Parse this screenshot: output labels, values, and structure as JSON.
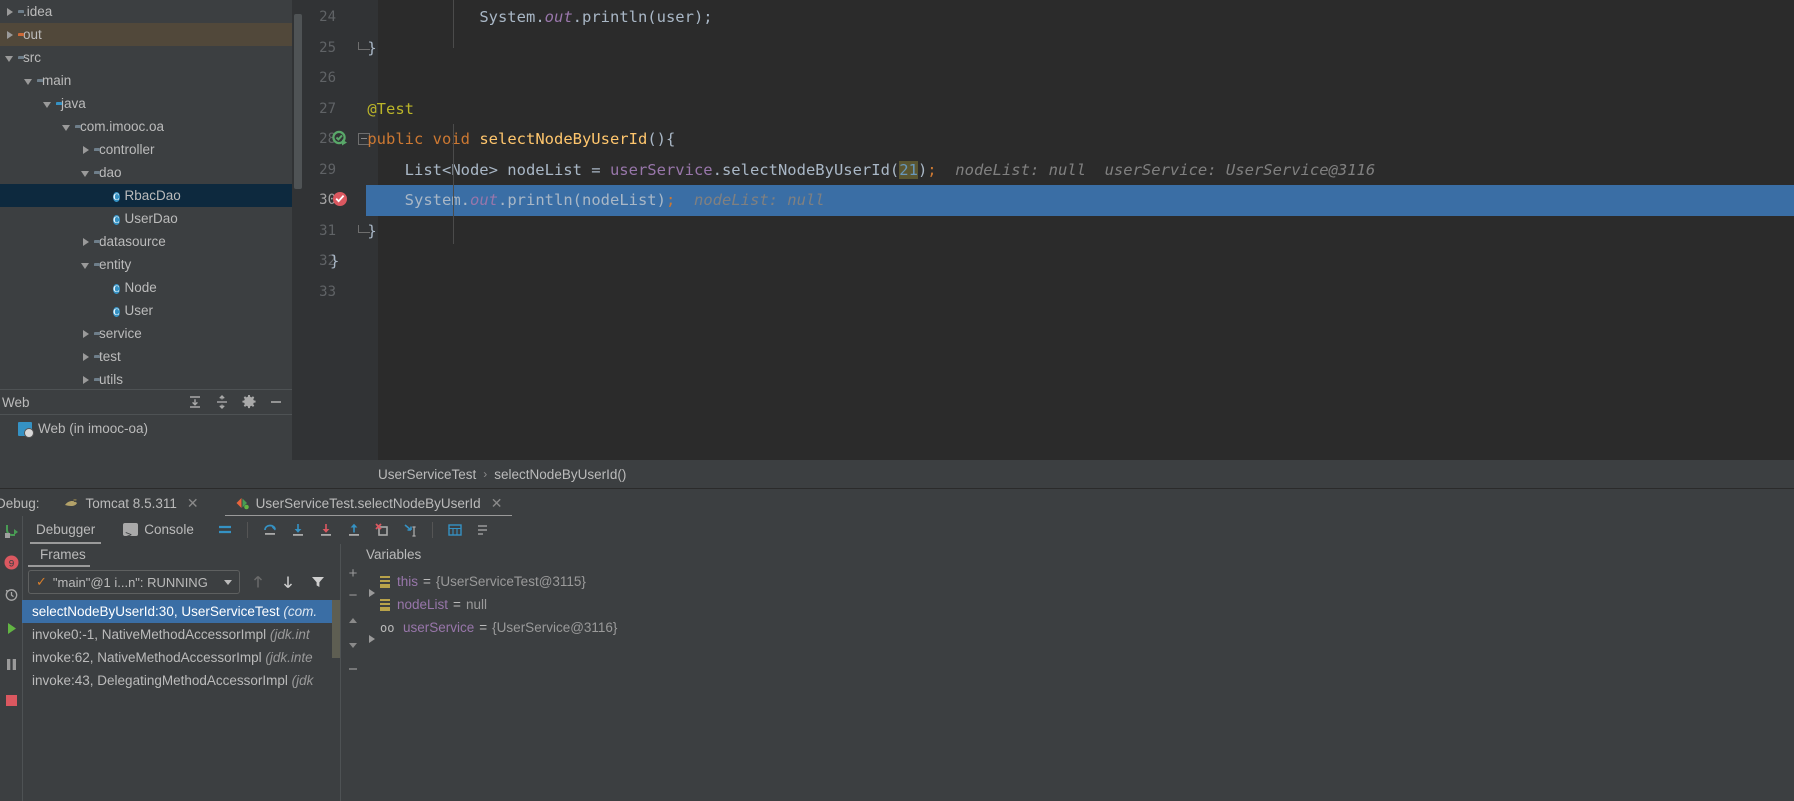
{
  "project_tree": {
    "items": [
      {
        "label": ".idea",
        "indent": 0,
        "arrow": "right",
        "icon": "folder-icon",
        "icon_color": "gray",
        "selected": "none"
      },
      {
        "label": "out",
        "indent": 0,
        "arrow": "right",
        "icon": "folder-icon",
        "icon_color": "orange",
        "selected": "out"
      },
      {
        "label": "src",
        "indent": 0,
        "arrow": "down",
        "icon": "folder-icon",
        "icon_color": "gray",
        "selected": "none"
      },
      {
        "label": "main",
        "indent": 1,
        "arrow": "down",
        "icon": "folder-icon",
        "icon_color": "gray",
        "selected": "none"
      },
      {
        "label": "java",
        "indent": 2,
        "arrow": "down",
        "icon": "folder-icon",
        "icon_color": "blue",
        "selected": "none"
      },
      {
        "label": "com.imooc.oa",
        "indent": 3,
        "arrow": "down",
        "icon": "package-icon",
        "icon_color": "gray",
        "selected": "none"
      },
      {
        "label": "controller",
        "indent": 4,
        "arrow": "right",
        "icon": "package-icon",
        "icon_color": "gray",
        "selected": "none"
      },
      {
        "label": "dao",
        "indent": 4,
        "arrow": "down",
        "icon": "package-icon",
        "icon_color": "gray",
        "selected": "none"
      },
      {
        "label": "RbacDao",
        "indent": 5,
        "arrow": "none",
        "icon": "java-class-icon",
        "icon_color": "blue",
        "selected": "blue"
      },
      {
        "label": "UserDao",
        "indent": 5,
        "arrow": "none",
        "icon": "java-class-icon",
        "icon_color": "blue",
        "selected": "none"
      },
      {
        "label": "datasource",
        "indent": 4,
        "arrow": "right",
        "icon": "package-icon",
        "icon_color": "gray",
        "selected": "none"
      },
      {
        "label": "entity",
        "indent": 4,
        "arrow": "down",
        "icon": "package-icon",
        "icon_color": "gray",
        "selected": "none"
      },
      {
        "label": "Node",
        "indent": 5,
        "arrow": "none",
        "icon": "java-class-icon",
        "icon_color": "blue",
        "selected": "none"
      },
      {
        "label": "User",
        "indent": 5,
        "arrow": "none",
        "icon": "java-class-icon",
        "icon_color": "blue",
        "selected": "none"
      },
      {
        "label": "service",
        "indent": 4,
        "arrow": "right",
        "icon": "package-icon",
        "icon_color": "gray",
        "selected": "none"
      },
      {
        "label": "test",
        "indent": 4,
        "arrow": "right",
        "icon": "package-icon",
        "icon_color": "gray",
        "selected": "none"
      },
      {
        "label": "utils",
        "indent": 4,
        "arrow": "right",
        "icon": "package-icon",
        "icon_color": "gray",
        "selected": "none"
      }
    ]
  },
  "web_panel": {
    "title": "Web",
    "toolbar": [
      "expand-all-icon",
      "collapse-all-icon",
      "settings-gear-icon",
      "hide-icon"
    ],
    "entry": "Web (in imooc-oa)"
  },
  "editor": {
    "lines": [
      {
        "no": "24",
        "indent": 4,
        "tokens": [
          {
            "t": "System",
            "c": "sem"
          },
          {
            "t": ".",
            "c": "sem"
          },
          {
            "t": "out",
            "c": "fld-italic"
          },
          {
            "t": ".println(user);",
            "c": "sem"
          }
        ]
      },
      {
        "no": "25",
        "indent": 1,
        "tokens": [
          {
            "t": "}",
            "c": "sem"
          }
        ],
        "fold": "end"
      },
      {
        "no": "26",
        "indent": 0,
        "tokens": []
      },
      {
        "no": "27",
        "indent": 1,
        "tokens": [
          {
            "t": "@Test",
            "c": "ann"
          }
        ]
      },
      {
        "no": "28",
        "indent": 1,
        "tokens": [
          {
            "t": "public ",
            "c": "kw"
          },
          {
            "t": "void ",
            "c": "kw"
          },
          {
            "t": "selectNodeByUserId",
            "c": "mth"
          },
          {
            "t": "(){",
            "c": "sem"
          }
        ],
        "gutter_icon": "run-test-icon",
        "fold": "start"
      },
      {
        "no": "29",
        "indent": 2,
        "tokens": [
          {
            "t": "List<Node> nodeList = ",
            "c": "sem"
          },
          {
            "t": "userService",
            "c": "fld"
          },
          {
            "t": ".selectNodeByUserId(",
            "c": "sem"
          },
          {
            "t": "21",
            "c": "num-hl"
          },
          {
            "t": ")",
            "c": "sem"
          },
          {
            "t": ";",
            "c": "semi"
          }
        ],
        "hints": [
          "nodeList: null",
          "userService: UserService@3116"
        ]
      },
      {
        "no": "30",
        "indent": 2,
        "tokens": [
          {
            "t": "System",
            "c": "sem"
          },
          {
            "t": ".",
            "c": "sem"
          },
          {
            "t": "out",
            "c": "fld-italic"
          },
          {
            "t": ".println(nodeList)",
            "c": "sem"
          },
          {
            "t": ";",
            "c": "semi"
          }
        ],
        "hints": [
          "nodeList: null"
        ],
        "gutter_icon": "breakpoint-hit-icon",
        "highlighted": true
      },
      {
        "no": "31",
        "indent": 1,
        "tokens": [
          {
            "t": "}",
            "c": "sem"
          }
        ],
        "fold": "end"
      },
      {
        "no": "32",
        "indent": 0,
        "tokens": [
          {
            "t": "}",
            "c": "sem"
          }
        ]
      },
      {
        "no": "33",
        "indent": 0,
        "tokens": []
      }
    ]
  },
  "breadcrumb": {
    "parts": [
      "UserServiceTest",
      "selectNodeByUserId()"
    ],
    "separator": "›"
  },
  "debug_tabbar": {
    "label": "Debug:",
    "tabs": [
      {
        "label": "Tomcat 8.5.311",
        "icon": "tomcat-icon",
        "active": false,
        "closable": true
      },
      {
        "label": "UserServiceTest.selectNodeByUserId",
        "icon": "debug-session-icon",
        "active": true,
        "closable": true
      }
    ]
  },
  "debug_panel": {
    "subtabs": [
      {
        "label": "Debugger",
        "icon": "",
        "active": true
      },
      {
        "label": "Console",
        "icon": "console-icon",
        "active": false
      }
    ],
    "toolbar_icons": [
      "layout-settings-icon",
      "step-over-icon",
      "step-into-icon",
      "force-step-into-icon",
      "step-out-icon",
      "drop-frame-icon",
      "run-to-cursor-icon",
      "evaluate-expression-icon",
      "watches-icon"
    ],
    "left_rail_icons": [
      "resume-program-icon",
      "mute-breakpoints-icon",
      "restore-layout-icon",
      "run-icon",
      "pause-icon",
      "stop-icon"
    ],
    "frames": {
      "title": "Frames",
      "thread": "\"main\"@1 i...n\": RUNNING",
      "thread_status_icon": "thread-running-check-icon",
      "frame_buttons": [
        "frame-up-icon",
        "frame-down-icon",
        "filter-icon"
      ],
      "list": [
        {
          "method": "selectNodeByUserId:30, UserServiceTest ",
          "pkg": "(com.",
          "selected": true
        },
        {
          "method": "invoke0:-1, NativeMethodAccessorImpl ",
          "pkg": "(jdk.int",
          "selected": false
        },
        {
          "method": "invoke:62, NativeMethodAccessorImpl ",
          "pkg": "(jdk.inte",
          "selected": false
        },
        {
          "method": "invoke:43, DelegatingMethodAccessorImpl ",
          "pkg": "(jdk",
          "selected": false
        }
      ]
    },
    "variables": {
      "title": "Variables",
      "column_buttons": [
        "add-watch-icon",
        "remove-watch-icon",
        "move-up-icon",
        "move-down-icon",
        "collapse-icon"
      ],
      "rows": [
        {
          "expandable": true,
          "icon": "field-icon",
          "name": "this",
          "value": "{UserServiceTest@3115}"
        },
        {
          "expandable": false,
          "icon": "field-icon",
          "name": "nodeList",
          "value": "null"
        },
        {
          "expandable": true,
          "icon": "reference-icon",
          "name": "userService",
          "value": "{UserService@3116}"
        }
      ]
    }
  },
  "colors": {
    "editor_bg": "#2b2b2b",
    "panel_bg": "#3c3f41",
    "gutter_bg": "#313335",
    "selection_blue": "#3a6ea5",
    "tree_select_blue": "#0d293e",
    "tree_select_tan": "#51483a",
    "keyword_orange": "#cc7832",
    "method_yellow": "#ffc66d",
    "field_purple": "#9876aa",
    "annotation_olive": "#bbb529",
    "number_blue": "#6897bb",
    "hint_gray": "#808080",
    "breakpoint_red": "#db5860"
  }
}
